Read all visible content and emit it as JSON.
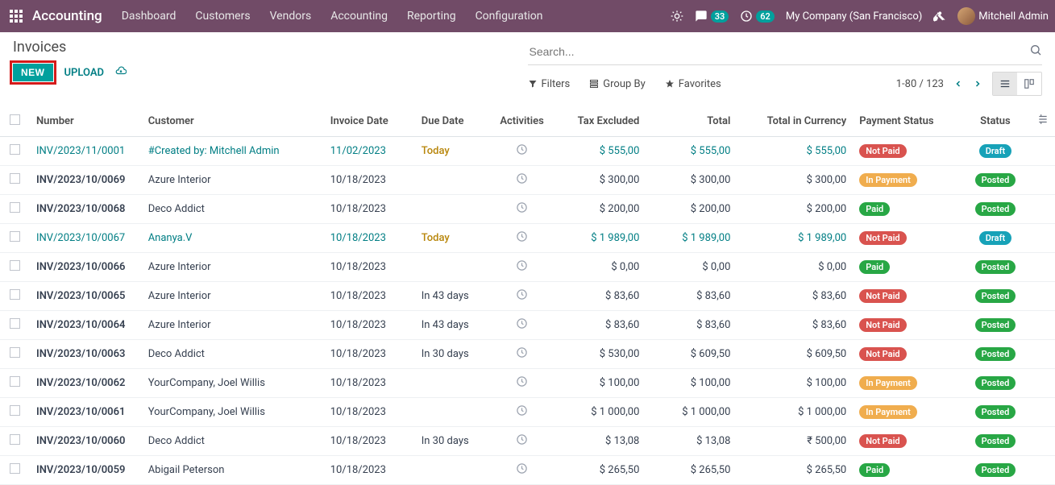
{
  "nav": {
    "brand": "Accounting",
    "items": [
      "Dashboard",
      "Customers",
      "Vendors",
      "Accounting",
      "Reporting",
      "Configuration"
    ],
    "chat_badge": "33",
    "clock_badge": "62",
    "company": "My Company (San Francisco)",
    "user": "Mitchell Admin"
  },
  "page": {
    "title": "Invoices",
    "btn_new": "NEW",
    "btn_upload": "UPLOAD",
    "search_placeholder": "Search...",
    "filters": "Filters",
    "group_by": "Group By",
    "favorites": "Favorites",
    "pager": "1-80 / 123"
  },
  "columns": {
    "number": "Number",
    "customer": "Customer",
    "invoice_date": "Invoice Date",
    "due_date": "Due Date",
    "activities": "Activities",
    "tax_excluded": "Tax Excluded",
    "total": "Total",
    "total_currency": "Total in Currency",
    "payment_status": "Payment Status",
    "status": "Status"
  },
  "rows": [
    {
      "number": "INV/2023/11/0001",
      "customer": "#Created by: Mitchell Admin",
      "invoice_date": "11/02/2023",
      "due_date": "Today",
      "tax": "$ 555,00",
      "total": "$ 555,00",
      "cur": "$ 555,00",
      "pay": "Not Paid",
      "pay_class": "pill-notpaid",
      "status": "Draft",
      "status_class": "pill-draft",
      "draft": true
    },
    {
      "number": "INV/2023/10/0069",
      "customer": "Azure Interior",
      "invoice_date": "10/18/2023",
      "due_date": "",
      "tax": "$ 300,00",
      "total": "$ 300,00",
      "cur": "$ 300,00",
      "pay": "In Payment",
      "pay_class": "pill-inpay",
      "status": "Posted",
      "status_class": "pill-posted"
    },
    {
      "number": "INV/2023/10/0068",
      "customer": "Deco Addict",
      "invoice_date": "10/18/2023",
      "due_date": "",
      "tax": "$ 200,00",
      "total": "$ 200,00",
      "cur": "$ 200,00",
      "pay": "Paid",
      "pay_class": "pill-paid",
      "status": "Posted",
      "status_class": "pill-posted"
    },
    {
      "number": "INV/2023/10/0067",
      "customer": "Ananya.V",
      "invoice_date": "10/18/2023",
      "due_date": "Today",
      "tax": "$ 1 989,00",
      "total": "$ 1 989,00",
      "cur": "$ 1 989,00",
      "pay": "Not Paid",
      "pay_class": "pill-notpaid",
      "status": "Draft",
      "status_class": "pill-draft",
      "draft": true
    },
    {
      "number": "INV/2023/10/0066",
      "customer": "Azure Interior",
      "invoice_date": "10/18/2023",
      "due_date": "",
      "tax": "$ 0,00",
      "total": "$ 0,00",
      "cur": "$ 0,00",
      "pay": "Paid",
      "pay_class": "pill-paid",
      "status": "Posted",
      "status_class": "pill-posted"
    },
    {
      "number": "INV/2023/10/0065",
      "customer": "Azure Interior",
      "invoice_date": "10/18/2023",
      "due_date": "In 43 days",
      "tax": "$ 83,60",
      "total": "$ 83,60",
      "cur": "$ 83,60",
      "pay": "Not Paid",
      "pay_class": "pill-notpaid",
      "status": "Posted",
      "status_class": "pill-posted"
    },
    {
      "number": "INV/2023/10/0064",
      "customer": "Azure Interior",
      "invoice_date": "10/18/2023",
      "due_date": "In 43 days",
      "tax": "$ 83,60",
      "total": "$ 83,60",
      "cur": "$ 83,60",
      "pay": "Not Paid",
      "pay_class": "pill-notpaid",
      "status": "Posted",
      "status_class": "pill-posted"
    },
    {
      "number": "INV/2023/10/0063",
      "customer": "Deco Addict",
      "invoice_date": "10/18/2023",
      "due_date": "In 30 days",
      "tax": "$ 530,00",
      "total": "$ 609,50",
      "cur": "$ 609,50",
      "pay": "Not Paid",
      "pay_class": "pill-notpaid",
      "status": "Posted",
      "status_class": "pill-posted"
    },
    {
      "number": "INV/2023/10/0062",
      "customer": "YourCompany, Joel Willis",
      "invoice_date": "10/18/2023",
      "due_date": "",
      "tax": "$ 100,00",
      "total": "$ 100,00",
      "cur": "$ 100,00",
      "pay": "In Payment",
      "pay_class": "pill-inpay",
      "status": "Posted",
      "status_class": "pill-posted"
    },
    {
      "number": "INV/2023/10/0061",
      "customer": "YourCompany, Joel Willis",
      "invoice_date": "10/18/2023",
      "due_date": "",
      "tax": "$ 1 000,00",
      "total": "$ 1 000,00",
      "cur": "$ 1 000,00",
      "pay": "In Payment",
      "pay_class": "pill-inpay",
      "status": "Posted",
      "status_class": "pill-posted"
    },
    {
      "number": "INV/2023/10/0060",
      "customer": "Deco Addict",
      "invoice_date": "10/18/2023",
      "due_date": "In 30 days",
      "tax": "$ 13,08",
      "total": "$ 13,08",
      "cur": "₹ 500,00",
      "pay": "Not Paid",
      "pay_class": "pill-notpaid",
      "status": "Posted",
      "status_class": "pill-posted"
    },
    {
      "number": "INV/2023/10/0059",
      "customer": "Abigail Peterson",
      "invoice_date": "10/18/2023",
      "due_date": "",
      "tax": "$ 265,50",
      "total": "$ 265,50",
      "cur": "$ 265,50",
      "pay": "Paid",
      "pay_class": "pill-paid",
      "status": "Posted",
      "status_class": "pill-posted"
    }
  ]
}
